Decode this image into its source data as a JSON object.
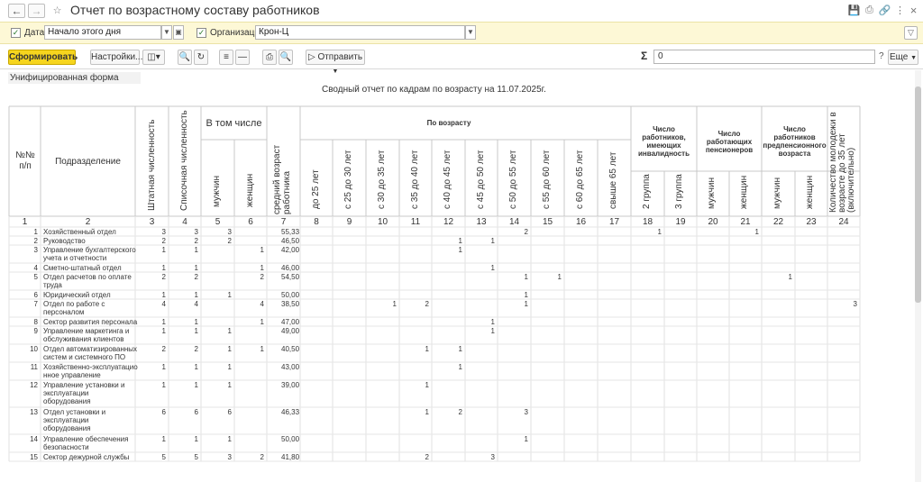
{
  "window": {
    "title": "Отчет по возрастному составу работников",
    "back_icon": "arrow-left-icon",
    "forward_icon": "arrow-right-icon"
  },
  "params": {
    "date_label": "Дата:",
    "date_value": "Начало этого дня",
    "org_label": "Организация:",
    "org_value": "Крон-Ц"
  },
  "toolbar": {
    "generate_label": "Сформировать",
    "settings_label": "Настройки...",
    "send_label": "Отправить",
    "sum_value": "0",
    "help_label": "?",
    "more_label": "Еще"
  },
  "report": {
    "form_label": "Унифицированная форма",
    "title": "Сводный отчет по кадрам по возрасту на 11.07.2025г.",
    "headers": {
      "num": "№№ п/п",
      "dept": "Подразделение",
      "staff": "Штатная численность",
      "list": "Списочная численность",
      "incl": "В том числе",
      "men": "мужчин",
      "women": "женщин",
      "avg": "средний возраст работника",
      "by_age": "По возрасту",
      "age_groups": [
        "до 25 лет",
        "с 25 до 30 лет",
        "с 30 до 35 лет",
        "с 35 до 40 лет",
        "с 40 до 45 лет",
        "с 45 до 50 лет",
        "с 50 до 55 лет",
        "с 55 до 60 лет",
        "с 60 до 65 лет",
        "свыше 65 лет"
      ],
      "disabled": "Число работников, имеющих инвалидность",
      "group2": "2 группа",
      "group3": "3 группа",
      "pensioners": "Число работающих пенсионеров",
      "prepension": "Число работников предпенсионного возраста",
      "pm": "мужчин",
      "pw": "женщин",
      "ppm": "мужчин",
      "ppw": "женщин",
      "young": "Количество молодежи в возрасте до 35 лет (включительно)"
    },
    "col_numbers": [
      "1",
      "2",
      "3",
      "4",
      "5",
      "6",
      "7",
      "8",
      "9",
      "10",
      "11",
      "12",
      "13",
      "14",
      "15",
      "16",
      "17",
      "18",
      "19",
      "20",
      "21",
      "22",
      "23",
      "24"
    ],
    "rows": [
      {
        "n": "1",
        "name": "Хозяйственный отдел",
        "lines": [
          "Хозяйственный отдел"
        ],
        "c": {
          "3": "3",
          "4": "3",
          "5": "3",
          "7": "55,33",
          "14": "2",
          "18": "1",
          "21": "1"
        }
      },
      {
        "n": "2",
        "name": "Руководство",
        "lines": [
          "Руководство"
        ],
        "c": {
          "3": "2",
          "4": "2",
          "5": "2",
          "7": "46,50",
          "12": "1",
          "13": "1"
        }
      },
      {
        "n": "3",
        "name": "Управление бухгалтерского учета и отчетности",
        "lines": [
          "Управление бухгалтерского",
          "учета и отчетности"
        ],
        "c": {
          "3": "1",
          "4": "1",
          "6": "1",
          "7": "42,00",
          "12": "1"
        }
      },
      {
        "n": "4",
        "name": "Сметно-штатный отдел",
        "lines": [
          "Сметно-штатный отдел"
        ],
        "c": {
          "3": "1",
          "4": "1",
          "6": "1",
          "7": "46,00",
          "13": "1"
        }
      },
      {
        "n": "5",
        "name": "Отдел расчетов по оплате труда",
        "lines": [
          "Отдел расчетов по оплате",
          "труда"
        ],
        "c": {
          "3": "2",
          "4": "2",
          "6": "2",
          "7": "54,50",
          "14": "1",
          "15": "1",
          "22": "1"
        }
      },
      {
        "n": "6",
        "name": "Юридический отдел",
        "lines": [
          "Юридический отдел"
        ],
        "c": {
          "3": "1",
          "4": "1",
          "5": "1",
          "7": "50,00",
          "14": "1"
        }
      },
      {
        "n": "7",
        "name": "Отдел по работе с персоналом",
        "lines": [
          "Отдел по работе с",
          "персоналом"
        ],
        "c": {
          "3": "4",
          "4": "4",
          "6": "4",
          "7": "38,50",
          "10": "1",
          "11": "2",
          "14": "1",
          "24": "3"
        }
      },
      {
        "n": "8",
        "name": "Сектор развития персонала",
        "lines": [
          "Сектор развития персонала"
        ],
        "c": {
          "3": "1",
          "4": "1",
          "6": "1",
          "7": "47,00",
          "13": "1"
        }
      },
      {
        "n": "9",
        "name": "Управление маркетинга и обслуживания клиентов",
        "lines": [
          "Управление маркетинга и",
          "обслуживания клиентов"
        ],
        "c": {
          "3": "1",
          "4": "1",
          "5": "1",
          "7": "49,00",
          "13": "1"
        }
      },
      {
        "n": "10",
        "name": "Отдел автоматизированных систем и системного ПО",
        "lines": [
          "Отдел автоматизированных",
          "систем и системного ПО"
        ],
        "c": {
          "3": "2",
          "4": "2",
          "5": "1",
          "6": "1",
          "7": "40,50",
          "11": "1",
          "12": "1"
        }
      },
      {
        "n": "11",
        "name": "Хозяйственно-эксплуатационное управление",
        "lines": [
          "Хозяйственно-эксплуатацио",
          "нное управление"
        ],
        "c": {
          "3": "1",
          "4": "1",
          "5": "1",
          "7": "43,00",
          "12": "1"
        }
      },
      {
        "n": "12",
        "name": "Управление установки и эксплуатации оборудования",
        "lines": [
          "Управление установки и",
          "эксплуатации",
          "оборудования"
        ],
        "c": {
          "3": "1",
          "4": "1",
          "5": "1",
          "7": "39,00",
          "11": "1"
        }
      },
      {
        "n": "13",
        "name": "Отдел установки и эксплуатации оборудования",
        "lines": [
          "Отдел установки и",
          "эксплуатации",
          "оборудования"
        ],
        "c": {
          "3": "6",
          "4": "6",
          "5": "6",
          "7": "46,33",
          "11": "1",
          "12": "2",
          "14": "3"
        }
      },
      {
        "n": "14",
        "name": "Управление обеспечения безопасности",
        "lines": [
          "Управление обеспечения",
          "безопасности"
        ],
        "c": {
          "3": "1",
          "4": "1",
          "5": "1",
          "7": "50,00",
          "14": "1"
        }
      },
      {
        "n": "15",
        "name": "Сектор дежурной службы",
        "lines": [
          "Сектор дежурной службы"
        ],
        "c": {
          "3": "5",
          "4": "5",
          "5": "3",
          "6": "2",
          "7": "41,80",
          "11": "2",
          "13": "3"
        }
      }
    ]
  }
}
